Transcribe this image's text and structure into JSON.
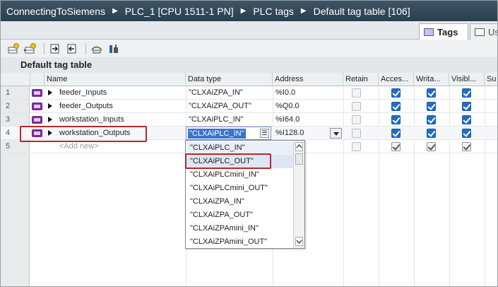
{
  "breadcrumb": [
    "ConnectingToSiemens",
    "PLC_1 [CPU 1511-1 PN]",
    "PLC tags",
    "Default tag table [106]"
  ],
  "tabs": [
    {
      "label": "Tags",
      "icon": "tag-table-icon",
      "active": true
    },
    {
      "label": "Us",
      "icon": "user-constants-icon",
      "active": false
    }
  ],
  "toolbar_icons": [
    "add-row-icon",
    "insert-row-icon",
    "export-icon",
    "import-icon",
    "monitor-icon",
    "settings-icon"
  ],
  "section_title": "Default tag table",
  "columns": [
    "Name",
    "Data type",
    "Address",
    "Retain",
    "Acces...",
    "Writa...",
    "Visibl...",
    "Su"
  ],
  "rows": [
    {
      "num": "1",
      "name": "feeder_Inputs",
      "data_type": "\"CLXAiZPA_IN\"",
      "address": "%I0.0",
      "retain": false,
      "accessible": true,
      "writable": true,
      "visible": true
    },
    {
      "num": "2",
      "name": "feeder_Outputs",
      "data_type": "\"CLXAiZPA_OUT\"",
      "address": "%Q0.0",
      "retain": false,
      "accessible": true,
      "writable": true,
      "visible": true
    },
    {
      "num": "3",
      "name": "workstation_Inputs",
      "data_type": "\"CLXAiPLC_IN\"",
      "address": "%I64.0",
      "retain": false,
      "accessible": true,
      "writable": true,
      "visible": true
    },
    {
      "num": "4",
      "name": "workstation_Outputs",
      "data_type": "\"CLXAiPLC_IN\"",
      "address": "%I128.0",
      "retain": false,
      "accessible": true,
      "writable": true,
      "visible": true
    },
    {
      "num": "5",
      "name": "<Add new>",
      "data_type": "",
      "address": "",
      "retain": false,
      "accessible": true,
      "writable": true,
      "visible": true
    }
  ],
  "dropdown_options": [
    "\"CLXAiPLC_IN\"",
    "\"CLXAiPLC_OUT\"",
    "\"CLXAiPLCmini_IN\"",
    "\"CLXAiPLCmini_OUT\"",
    "\"CLXAiZPA_IN\"",
    "\"CLXAiZPA_OUT\"",
    "\"CLXAiZPAmini_IN\"",
    "\"CLXAiZPAmini_OUT\""
  ],
  "dropdown_hover_index": 1,
  "colors": {
    "titlebar": "#34495a",
    "tag_icon": "#7b2a9a",
    "checkbox": "#1e6ec8",
    "highlight": "#b8282e",
    "selection": "#3c74c8"
  }
}
